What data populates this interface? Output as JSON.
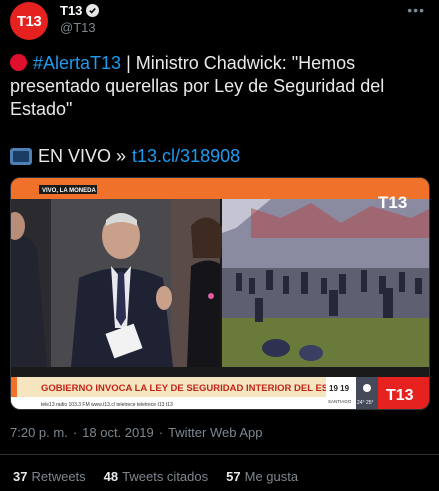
{
  "account": {
    "avatar_text": "T13",
    "display_name": "T13",
    "handle": "@T13",
    "verified": true
  },
  "tweet": {
    "hashtag": "#AlertaT13",
    "text_rest": " | Ministro Chadwick: \"Hemos presentado querellas por Ley de Seguridad del Estado\"",
    "live_label": "EN VIVO »",
    "link": "t13.cl/318908"
  },
  "media": {
    "location_tag": "VIVO, LA MONEDA",
    "channel_logo": "T13",
    "headline": "GOBIERNO INVOCA LA LEY DE SEGURIDAD INTERIOR DEL ESTADO",
    "ticker": "tele13 radio 103.3 FM  www.t13.cl  teletrece  teletrece  t13  t13",
    "time": "19 19",
    "weather_city": "SANTIAGO",
    "weather_temp": "24° 25°",
    "footer_logo": "T13"
  },
  "meta": {
    "time": "7:20 p. m.",
    "sep1": "·",
    "date": "18 oct. 2019",
    "sep2": "·",
    "source": "Twitter Web App"
  },
  "stats": {
    "retweets_count": "37",
    "retweets_label": "Retweets",
    "quotes_count": "48",
    "quotes_label": "Tweets citados",
    "likes_count": "57",
    "likes_label": "Me gusta"
  },
  "colors": {
    "background": "#000000",
    "link": "#1d9bf0",
    "brand_red": "#e5221f",
    "banner_orange": "#f0712a"
  },
  "icons": [
    "verified-icon",
    "more-icon",
    "red-circle-icon",
    "tv-icon",
    "sun-icon"
  ]
}
